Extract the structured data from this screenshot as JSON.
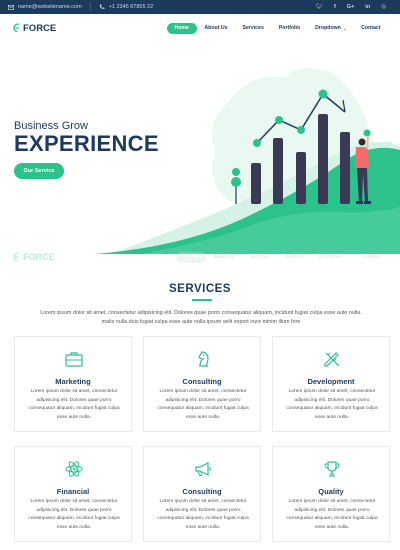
{
  "topbar": {
    "email": "name@websitename.com",
    "phone": "+1 2345 67855 22",
    "socials": [
      "twitter-icon",
      "facebook-icon",
      "google-plus-icon",
      "linkedin-icon",
      "dribbble-icon"
    ]
  },
  "header": {
    "logo": "FORCE",
    "nav": [
      {
        "label": "Home"
      },
      {
        "label": "About Us"
      },
      {
        "label": "Services"
      },
      {
        "label": "Portfolio"
      },
      {
        "label": "Dropdown"
      },
      {
        "label": "Contact"
      }
    ]
  },
  "hero": {
    "subtitle": "Business Grow",
    "title": "EXPERIENCE",
    "button": "Our Service"
  },
  "services": {
    "title": "SERVICES",
    "description": "Lorem ipsum dolor sit amet, consectetur adipisicing elit. Dolores quae porro consequatur aliquam, incidunt fugiat culpa esse aute nulla. malis nulla duis fugiat culpa esse aute nulla ipsum velit export irure minim illum fore",
    "cards": [
      {
        "title": "Marketing",
        "icon": "briefcase-icon",
        "text": "Lorem ipsum dolor sit amet, consectetur adipisicing elit. Dolores quae porro consequatur aliquam, incidunt fugiat culpa esse aute nulla."
      },
      {
        "title": "Consulting",
        "icon": "chess-knight-icon",
        "text": "Lorem ipsum dolor sit amet, consectetur adipisicing elit. Dolores quae porro consequatur aliquam, incidunt fugiat culpa esse aute nulla."
      },
      {
        "title": "Development",
        "icon": "pencil-ruler-icon",
        "text": "Lorem ipsum dolor sit amet, consectetur adipisicing elit. Dolores quae porro consequatur aliquam, incidunt fugiat culpa esse aute nulla."
      },
      {
        "title": "Financial",
        "icon": "atom-icon",
        "text": "Lorem ipsum dolor sit amet, consectetur adipisicing elit. Dolores quae porro consequatur aliquam, incidunt fugiat culpa esse aute nulla."
      },
      {
        "title": "Consulting",
        "icon": "megaphone-icon",
        "text": "Lorem ipsum dolor sit amet, consectetur adipisicing elit. Dolores quae porro consequatur aliquam, incidunt fugiat culpa esse aute nulla."
      },
      {
        "title": "Quality",
        "icon": "trophy-icon",
        "text": "Lorem ipsum dolor sit amet, consectetur adipisicing elit. Dolores quae porro consequatur aliquam, incidunt fugiat culpa esse aute nulla."
      }
    ]
  },
  "colors": {
    "accent": "#2bc28c",
    "navy": "#1b3a5c",
    "topbar": "#1b3a5c"
  }
}
